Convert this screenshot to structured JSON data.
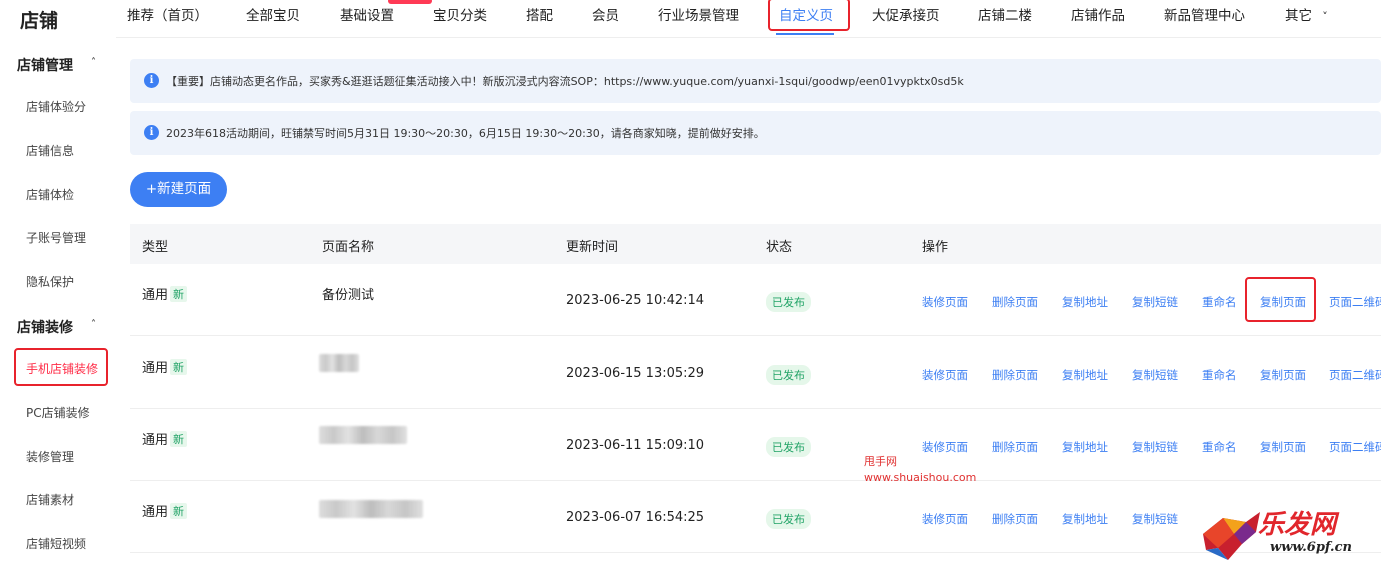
{
  "sidebar": {
    "brand": "店铺",
    "group1": {
      "title": "店铺管理",
      "caret": "˄"
    },
    "group1_items": [
      "店铺体验分",
      "店铺信息",
      "店铺体检",
      "子账号管理",
      "隐私保护"
    ],
    "group2": {
      "title": "店铺装修",
      "caret": "˄"
    },
    "group2_items": [
      "手机店铺装修",
      "PC店铺装修",
      "装修管理",
      "店铺素材",
      "店铺短视频"
    ]
  },
  "topnav": {
    "items": [
      "推荐（首页）",
      "全部宝贝",
      "基础设置",
      "宝贝分类",
      "搭配",
      "会员",
      "行业场景管理",
      "自定义页",
      "大促承接页",
      "店铺二楼",
      "店铺作品",
      "新品管理中心",
      "其它"
    ],
    "active_index": 7,
    "more_caret": "˅"
  },
  "notices": [
    {
      "icon": "info-icon",
      "icon_glyph": "i",
      "text": "【重要】店铺动态更名作品，买家秀&逛逛话题征集活动接入中！新版沉浸式内容流SOP：https://www.yuque.com/yuanxi-1squi/goodwp/een01vypktx0sd5k"
    },
    {
      "icon": "info-icon",
      "icon_glyph": "i",
      "text": "2023年618活动期间，旺铺禁写时间5月31日 19:30～20:30，6月15日 19:30～20:30，请各商家知晓，提前做好安排。"
    }
  ],
  "new_page_button": "+新建页面",
  "table": {
    "headers": [
      "类型",
      "页面名称",
      "更新时间",
      "状态",
      "操作"
    ],
    "rows": [
      {
        "type": "通用",
        "tag": "新",
        "name": "备份测试",
        "updated": "2023-06-25 10:42:14",
        "status": "已发布"
      },
      {
        "type": "通用",
        "tag": "新",
        "name": "",
        "updated": "2023-06-15 13:05:29",
        "status": "已发布"
      },
      {
        "type": "通用",
        "tag": "新",
        "name": "",
        "updated": "2023-06-11 15:09:10",
        "status": "已发布"
      },
      {
        "type": "通用",
        "tag": "新",
        "name": "",
        "updated": "2023-06-07 16:54:25",
        "status": "已发布"
      }
    ],
    "actions": [
      "装修页面",
      "删除页面",
      "复制地址",
      "复制短链",
      "重命名",
      "复制页面",
      "页面二维码"
    ]
  },
  "watermark": {
    "line1": "甩手网",
    "line2": "www.shuaishou.com"
  },
  "logo": {
    "name": "乐发网",
    "url": "www.6pf.cn"
  },
  "colors": {
    "accent": "#3d7ff3",
    "active_red": "#ff2b46",
    "success": "#21a366",
    "highlight_box": "#e8232c"
  }
}
